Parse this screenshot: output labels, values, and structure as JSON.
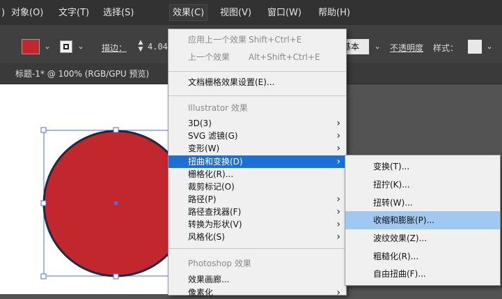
{
  "menubar": {
    "items": [
      {
        "label": ")"
      },
      {
        "label": "对象(O)"
      },
      {
        "label": "文字(T)"
      },
      {
        "label": "选择(S)"
      },
      {
        "label": "效果(C)"
      },
      {
        "label": "视图(V)"
      },
      {
        "label": "窗口(W)"
      },
      {
        "label": "帮助(H)"
      }
    ]
  },
  "controlbar": {
    "fill_color": "#c1272d",
    "stroke_label": "描边：",
    "stroke_value": "4.04",
    "basic_label": "基本",
    "opacity_label": "不透明度",
    "style_label": "样式："
  },
  "document": {
    "tab_title": "标题-1* @ 100% (RGB/GPU 预览)"
  },
  "effect_menu": {
    "apply_last": {
      "label": "应用上一个效果",
      "shortcut": "Shift+Ctrl+E"
    },
    "last_effect": {
      "label": "上一个效果",
      "shortcut": "Alt+Shift+Ctrl+E"
    },
    "raster_settings": "文档栅格效果设置(E)...",
    "illustrator_section": "Illustrator 效果",
    "illustrator_items": [
      {
        "label": "3D(3)"
      },
      {
        "label": "SVG 滤镜(G)"
      },
      {
        "label": "变形(W)"
      },
      {
        "label": "扭曲和变换(D)"
      },
      {
        "label": "栅格化(R)..."
      },
      {
        "label": "裁剪标记(O)"
      },
      {
        "label": "路径(P)"
      },
      {
        "label": "路径查找器(F)"
      },
      {
        "label": "转换为形状(V)"
      },
      {
        "label": "风格化(S)"
      }
    ],
    "photoshop_section": "Photoshop 效果",
    "photoshop_items": [
      {
        "label": "效果画廊..."
      },
      {
        "label": "像素化"
      }
    ]
  },
  "distort_submenu": {
    "items": [
      {
        "label": "变换(T)..."
      },
      {
        "label": "扭拧(K)..."
      },
      {
        "label": "扭转(W)..."
      },
      {
        "label": "收缩和膨胀(P)..."
      },
      {
        "label": "波纹效果(Z)..."
      },
      {
        "label": "粗糙化(R)..."
      },
      {
        "label": "自由扭曲(F)..."
      }
    ]
  },
  "colors": {
    "circle_fill": "#c1272d",
    "circle_stroke": "#1f2a44",
    "selection": "#4a6fd8",
    "menu_highlight": "#1c6fd6",
    "submenu_highlight": "#9fc9f0"
  }
}
